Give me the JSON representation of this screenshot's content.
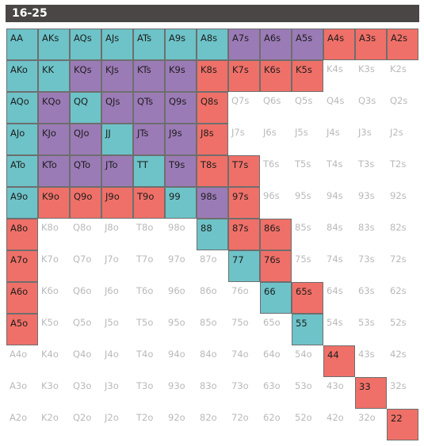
{
  "title": "16-25",
  "colors": {
    "teal": "#6dc3c8",
    "purple": "#9b7bb6",
    "red": "#ef7068",
    "none": "#ffffff",
    "title_bar": "#4a4645"
  },
  "rows": [
    [
      {
        "label": "AA",
        "color": "teal"
      },
      {
        "label": "AKs",
        "color": "teal"
      },
      {
        "label": "AQs",
        "color": "teal"
      },
      {
        "label": "AJs",
        "color": "teal"
      },
      {
        "label": "ATs",
        "color": "teal"
      },
      {
        "label": "A9s",
        "color": "teal"
      },
      {
        "label": "A8s",
        "color": "teal"
      },
      {
        "label": "A7s",
        "color": "purple"
      },
      {
        "label": "A6s",
        "color": "purple"
      },
      {
        "label": "A5s",
        "color": "purple"
      },
      {
        "label": "A4s",
        "color": "red"
      },
      {
        "label": "A3s",
        "color": "red"
      },
      {
        "label": "A2s",
        "color": "red"
      }
    ],
    [
      {
        "label": "AKo",
        "color": "teal"
      },
      {
        "label": "KK",
        "color": "teal"
      },
      {
        "label": "KQs",
        "color": "purple"
      },
      {
        "label": "KJs",
        "color": "purple"
      },
      {
        "label": "KTs",
        "color": "purple"
      },
      {
        "label": "K9s",
        "color": "purple"
      },
      {
        "label": "K8s",
        "color": "red"
      },
      {
        "label": "K7s",
        "color": "red"
      },
      {
        "label": "K6s",
        "color": "red"
      },
      {
        "label": "K5s",
        "color": "red"
      },
      {
        "label": "K4s",
        "color": "none"
      },
      {
        "label": "K3s",
        "color": "none"
      },
      {
        "label": "K2s",
        "color": "none"
      }
    ],
    [
      {
        "label": "AQo",
        "color": "teal"
      },
      {
        "label": "KQo",
        "color": "purple"
      },
      {
        "label": "QQ",
        "color": "teal"
      },
      {
        "label": "QJs",
        "color": "purple"
      },
      {
        "label": "QTs",
        "color": "purple"
      },
      {
        "label": "Q9s",
        "color": "purple"
      },
      {
        "label": "Q8s",
        "color": "red"
      },
      {
        "label": "Q7s",
        "color": "none"
      },
      {
        "label": "Q6s",
        "color": "none"
      },
      {
        "label": "Q5s",
        "color": "none"
      },
      {
        "label": "Q4s",
        "color": "none"
      },
      {
        "label": "Q3s",
        "color": "none"
      },
      {
        "label": "Q2s",
        "color": "none"
      }
    ],
    [
      {
        "label": "AJo",
        "color": "teal"
      },
      {
        "label": "KJo",
        "color": "purple"
      },
      {
        "label": "QJo",
        "color": "purple"
      },
      {
        "label": "JJ",
        "color": "teal"
      },
      {
        "label": "JTs",
        "color": "purple"
      },
      {
        "label": "J9s",
        "color": "purple"
      },
      {
        "label": "J8s",
        "color": "red"
      },
      {
        "label": "J7s",
        "color": "none"
      },
      {
        "label": "J6s",
        "color": "none"
      },
      {
        "label": "J5s",
        "color": "none"
      },
      {
        "label": "J4s",
        "color": "none"
      },
      {
        "label": "J3s",
        "color": "none"
      },
      {
        "label": "J2s",
        "color": "none"
      }
    ],
    [
      {
        "label": "ATo",
        "color": "teal"
      },
      {
        "label": "KTo",
        "color": "purple"
      },
      {
        "label": "QTo",
        "color": "purple"
      },
      {
        "label": "JTo",
        "color": "purple"
      },
      {
        "label": "TT",
        "color": "teal"
      },
      {
        "label": "T9s",
        "color": "purple"
      },
      {
        "label": "T8s",
        "color": "red"
      },
      {
        "label": "T7s",
        "color": "red"
      },
      {
        "label": "T6s",
        "color": "none"
      },
      {
        "label": "T5s",
        "color": "none"
      },
      {
        "label": "T4s",
        "color": "none"
      },
      {
        "label": "T3s",
        "color": "none"
      },
      {
        "label": "T2s",
        "color": "none"
      }
    ],
    [
      {
        "label": "A9o",
        "color": "teal"
      },
      {
        "label": "K9o",
        "color": "red"
      },
      {
        "label": "Q9o",
        "color": "red"
      },
      {
        "label": "J9o",
        "color": "red"
      },
      {
        "label": "T9o",
        "color": "red"
      },
      {
        "label": "99",
        "color": "teal"
      },
      {
        "label": "98s",
        "color": "purple"
      },
      {
        "label": "97s",
        "color": "red"
      },
      {
        "label": "96s",
        "color": "none"
      },
      {
        "label": "95s",
        "color": "none"
      },
      {
        "label": "94s",
        "color": "none"
      },
      {
        "label": "93s",
        "color": "none"
      },
      {
        "label": "92s",
        "color": "none"
      }
    ],
    [
      {
        "label": "A8o",
        "color": "red"
      },
      {
        "label": "K8o",
        "color": "none"
      },
      {
        "label": "Q8o",
        "color": "none"
      },
      {
        "label": "J8o",
        "color": "none"
      },
      {
        "label": "T8o",
        "color": "none"
      },
      {
        "label": "98o",
        "color": "none"
      },
      {
        "label": "88",
        "color": "teal"
      },
      {
        "label": "87s",
        "color": "red"
      },
      {
        "label": "86s",
        "color": "red"
      },
      {
        "label": "85s",
        "color": "none"
      },
      {
        "label": "84s",
        "color": "none"
      },
      {
        "label": "83s",
        "color": "none"
      },
      {
        "label": "82s",
        "color": "none"
      }
    ],
    [
      {
        "label": "A7o",
        "color": "red"
      },
      {
        "label": "K7o",
        "color": "none"
      },
      {
        "label": "Q7o",
        "color": "none"
      },
      {
        "label": "J7o",
        "color": "none"
      },
      {
        "label": "T7o",
        "color": "none"
      },
      {
        "label": "97o",
        "color": "none"
      },
      {
        "label": "87o",
        "color": "none"
      },
      {
        "label": "77",
        "color": "teal"
      },
      {
        "label": "76s",
        "color": "red"
      },
      {
        "label": "75s",
        "color": "none"
      },
      {
        "label": "74s",
        "color": "none"
      },
      {
        "label": "73s",
        "color": "none"
      },
      {
        "label": "72s",
        "color": "none"
      }
    ],
    [
      {
        "label": "A6o",
        "color": "red"
      },
      {
        "label": "K6o",
        "color": "none"
      },
      {
        "label": "Q6o",
        "color": "none"
      },
      {
        "label": "J6o",
        "color": "none"
      },
      {
        "label": "T6o",
        "color": "none"
      },
      {
        "label": "96o",
        "color": "none"
      },
      {
        "label": "86o",
        "color": "none"
      },
      {
        "label": "76o",
        "color": "none"
      },
      {
        "label": "66",
        "color": "teal"
      },
      {
        "label": "65s",
        "color": "red"
      },
      {
        "label": "64s",
        "color": "none"
      },
      {
        "label": "63s",
        "color": "none"
      },
      {
        "label": "62s",
        "color": "none"
      }
    ],
    [
      {
        "label": "A5o",
        "color": "red"
      },
      {
        "label": "K5o",
        "color": "none"
      },
      {
        "label": "Q5o",
        "color": "none"
      },
      {
        "label": "J5o",
        "color": "none"
      },
      {
        "label": "T5o",
        "color": "none"
      },
      {
        "label": "95o",
        "color": "none"
      },
      {
        "label": "85o",
        "color": "none"
      },
      {
        "label": "75o",
        "color": "none"
      },
      {
        "label": "65o",
        "color": "none"
      },
      {
        "label": "55",
        "color": "teal"
      },
      {
        "label": "54s",
        "color": "none"
      },
      {
        "label": "53s",
        "color": "none"
      },
      {
        "label": "52s",
        "color": "none"
      }
    ],
    [
      {
        "label": "A4o",
        "color": "none"
      },
      {
        "label": "K4o",
        "color": "none"
      },
      {
        "label": "Q4o",
        "color": "none"
      },
      {
        "label": "J4o",
        "color": "none"
      },
      {
        "label": "T4o",
        "color": "none"
      },
      {
        "label": "94o",
        "color": "none"
      },
      {
        "label": "84o",
        "color": "none"
      },
      {
        "label": "74o",
        "color": "none"
      },
      {
        "label": "64o",
        "color": "none"
      },
      {
        "label": "54o",
        "color": "none"
      },
      {
        "label": "44",
        "color": "red"
      },
      {
        "label": "43s",
        "color": "none"
      },
      {
        "label": "42s",
        "color": "none"
      }
    ],
    [
      {
        "label": "A3o",
        "color": "none"
      },
      {
        "label": "K3o",
        "color": "none"
      },
      {
        "label": "Q3o",
        "color": "none"
      },
      {
        "label": "J3o",
        "color": "none"
      },
      {
        "label": "T3o",
        "color": "none"
      },
      {
        "label": "93o",
        "color": "none"
      },
      {
        "label": "83o",
        "color": "none"
      },
      {
        "label": "73o",
        "color": "none"
      },
      {
        "label": "63o",
        "color": "none"
      },
      {
        "label": "53o",
        "color": "none"
      },
      {
        "label": "43o",
        "color": "none"
      },
      {
        "label": "33",
        "color": "red"
      },
      {
        "label": "32s",
        "color": "none"
      }
    ],
    [
      {
        "label": "A2o",
        "color": "none"
      },
      {
        "label": "K2o",
        "color": "none"
      },
      {
        "label": "Q2o",
        "color": "none"
      },
      {
        "label": "J2o",
        "color": "none"
      },
      {
        "label": "T2o",
        "color": "none"
      },
      {
        "label": "92o",
        "color": "none"
      },
      {
        "label": "82o",
        "color": "none"
      },
      {
        "label": "72o",
        "color": "none"
      },
      {
        "label": "62o",
        "color": "none"
      },
      {
        "label": "52o",
        "color": "none"
      },
      {
        "label": "42o",
        "color": "none"
      },
      {
        "label": "32o",
        "color": "none"
      },
      {
        "label": "22",
        "color": "red"
      }
    ]
  ]
}
